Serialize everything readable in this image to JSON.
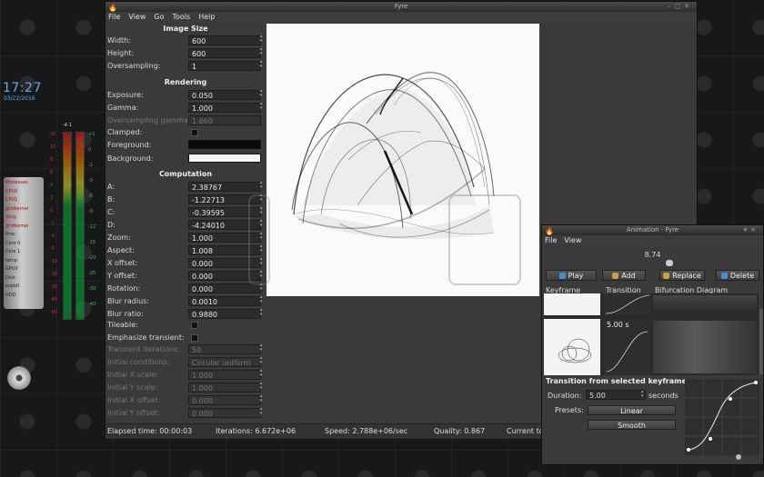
{
  "desktop": {
    "clock": "17:27",
    "clock_date": "03/22/2016",
    "sysmon_lines": [
      "Processes",
      "CPU0",
      "CPU1",
      "gridkernel",
      "Xorg",
      "gridkernel",
      "Proc",
      "Core 0",
      "Core 1",
      "temp",
      "GPU0",
      "Disk",
      "espb0",
      "HDD"
    ],
    "meter_top": "-4.1",
    "meter_left_ticks": [
      "20",
      "10",
      "8",
      "6",
      "4",
      "2",
      "0",
      "-2",
      "-4",
      "-6",
      "-10",
      "-20",
      "-30",
      "-40",
      "-60"
    ],
    "meter_right_ticks": [
      "+1",
      "0",
      "-1",
      "-3",
      "-6",
      "-9",
      "-12",
      "-15",
      "-20",
      "-25",
      "-30",
      "-40"
    ]
  },
  "main": {
    "title": "Fyre",
    "menu": [
      "File",
      "View",
      "Go",
      "Tools",
      "Help"
    ],
    "sections": {
      "image_size": "Image Size",
      "rendering": "Rendering",
      "computation": "Computation"
    },
    "image_size": [
      {
        "label": "Width:",
        "value": "600"
      },
      {
        "label": "Height:",
        "value": "600"
      },
      {
        "label": "Oversampling:",
        "value": "1"
      }
    ],
    "rendering": {
      "exposure": {
        "label": "Exposure:",
        "value": "0.050"
      },
      "gamma": {
        "label": "Gamma:",
        "value": "1.000"
      },
      "os_gamma": {
        "label": "Oversampling gamma:",
        "value": "1.660"
      },
      "clamped": {
        "label": "Clamped:"
      },
      "foreground": {
        "label": "Foreground:",
        "color": "#0a0a0a"
      },
      "background": {
        "label": "Background:",
        "color": "#f5f5f5"
      }
    },
    "computation": [
      {
        "label": "A:",
        "value": "2.38767"
      },
      {
        "label": "B:",
        "value": "-1.22713"
      },
      {
        "label": "C:",
        "value": "-0.39595"
      },
      {
        "label": "D:",
        "value": "-4.24010"
      },
      {
        "label": "Zoom:",
        "value": "1.000"
      },
      {
        "label": "Aspect:",
        "value": "1.008"
      },
      {
        "label": "X offset:",
        "value": "0.000"
      },
      {
        "label": "Y offset:",
        "value": "0.000"
      },
      {
        "label": "Rotation:",
        "value": "0.000"
      },
      {
        "label": "Blur radius:",
        "value": "0.0010"
      },
      {
        "label": "Blur ratio:",
        "value": "0.9880"
      }
    ],
    "tileable": "Tileable:",
    "emphasize": "Emphasize transient:",
    "disabled_rows": [
      {
        "label": "Transient iterations:",
        "value": "50"
      },
      {
        "label": "Initial conditions:",
        "value": "Circular uniform"
      },
      {
        "label": "Initial X scale:",
        "value": "1.000"
      },
      {
        "label": "Initial Y scale:",
        "value": "1.000"
      },
      {
        "label": "Initial X offset:",
        "value": "0.000"
      },
      {
        "label": "Initial Y offset:",
        "value": "0.000"
      }
    ],
    "status": {
      "elapsed": "Elapsed time: 00:00:03",
      "iterations": "Iterations: 6.672e+06",
      "speed": "Speed: 2.788e+06/sec",
      "quality": "Quality: 0.867",
      "current": "Current too"
    }
  },
  "animation": {
    "title": "Animation - Fyre",
    "menu": [
      "File",
      "View"
    ],
    "time_value": "8.74",
    "buttons": {
      "play": "Play",
      "add": "Add",
      "replace": "Replace",
      "delete": "Delete"
    },
    "columns": {
      "keyframe": "Keyframe",
      "transition": "Transition",
      "bifurcation": "Bifurcation Diagram"
    },
    "selected_duration_badge": "5.00 s",
    "section_label": "Transition from selected keyframe:",
    "duration_label": "Duration:",
    "duration_value": "5.00",
    "duration_unit": "seconds",
    "presets_label": "Presets:",
    "preset_linear": "Linear",
    "preset_smooth": "Smooth"
  }
}
